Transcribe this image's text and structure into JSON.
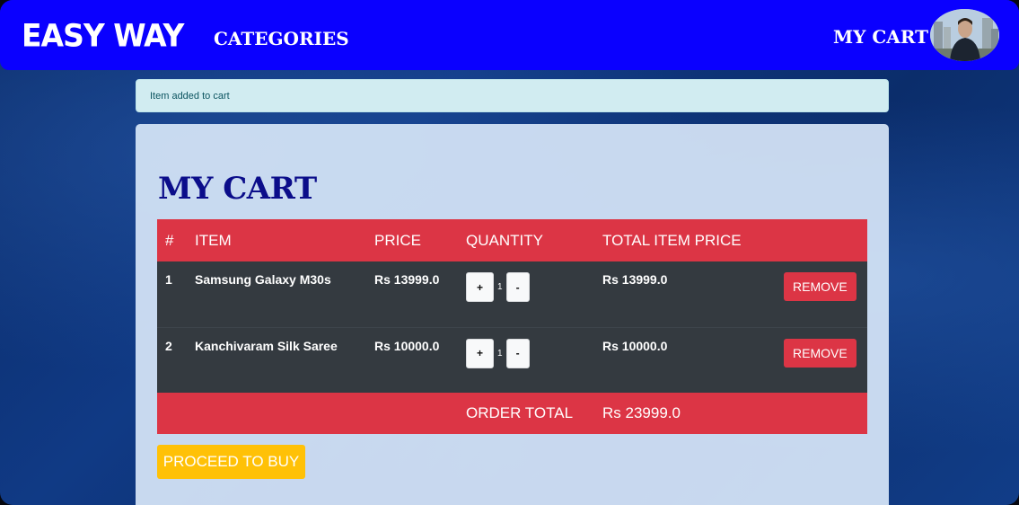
{
  "navbar": {
    "brand": "EASY WAY",
    "categories": "CATEGORIES",
    "cart": "MY CART"
  },
  "alert": {
    "message": "Item added to cart"
  },
  "cart": {
    "title": "MY CART",
    "headers": [
      "#",
      "ITEM",
      "PRICE",
      "QUANTITY",
      "TOTAL ITEM PRICE"
    ],
    "items": [
      {
        "index": "1",
        "name": "Samsung Galaxy M30s",
        "price": "Rs 13999.0",
        "quantity": "1",
        "total": "Rs 13999.0",
        "remove": "REMOVE"
      },
      {
        "index": "2",
        "name": "Kanchivaram Silk Saree",
        "price": "Rs 10000.0",
        "quantity": "1",
        "total": "Rs 10000.0",
        "remove": "REMOVE"
      }
    ],
    "qty_plus": "+",
    "qty_minus": "-",
    "order_total_label": "ORDER TOTAL",
    "order_total_value": "Rs 23999.0",
    "proceed": "PROCEED TO BUY"
  },
  "colors": {
    "navbar": "#0a00ff",
    "table_header": "#dc3545",
    "table_row": "#343a40",
    "proceed_button": "#ffc107",
    "title": "#0b0d8a"
  }
}
